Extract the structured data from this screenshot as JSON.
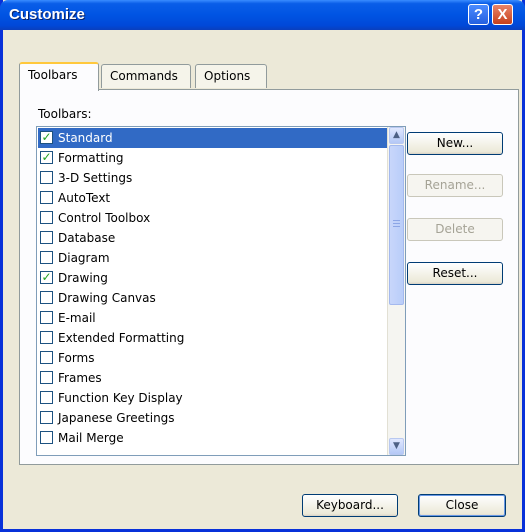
{
  "window": {
    "title": "Customize",
    "help_label": "?",
    "close_label": "X"
  },
  "tabs": [
    {
      "label": "Toolbars",
      "active": true
    },
    {
      "label": "Commands",
      "active": false
    },
    {
      "label": "Options",
      "active": false
    }
  ],
  "toolbars_label": "Toolbars:",
  "toolbars": [
    {
      "name": "Standard",
      "checked": true,
      "selected": true
    },
    {
      "name": "Formatting",
      "checked": true,
      "selected": false
    },
    {
      "name": "3-D Settings",
      "checked": false,
      "selected": false
    },
    {
      "name": "AutoText",
      "checked": false,
      "selected": false
    },
    {
      "name": "Control Toolbox",
      "checked": false,
      "selected": false
    },
    {
      "name": "Database",
      "checked": false,
      "selected": false
    },
    {
      "name": "Diagram",
      "checked": false,
      "selected": false
    },
    {
      "name": "Drawing",
      "checked": true,
      "selected": false
    },
    {
      "name": "Drawing Canvas",
      "checked": false,
      "selected": false
    },
    {
      "name": "E-mail",
      "checked": false,
      "selected": false
    },
    {
      "name": "Extended Formatting",
      "checked": false,
      "selected": false
    },
    {
      "name": "Forms",
      "checked": false,
      "selected": false
    },
    {
      "name": "Frames",
      "checked": false,
      "selected": false
    },
    {
      "name": "Function Key Display",
      "checked": false,
      "selected": false
    },
    {
      "name": "Japanese Greetings",
      "checked": false,
      "selected": false
    },
    {
      "name": "Mail Merge",
      "checked": false,
      "selected": false
    }
  ],
  "side_buttons": {
    "new": "New...",
    "rename": "Rename...",
    "delete": "Delete",
    "reset": "Reset..."
  },
  "bottom_buttons": {
    "keyboard": "Keyboard...",
    "close": "Close"
  },
  "colors": {
    "titlebar": "#0054e3",
    "selection": "#316ac5",
    "check": "#21a121"
  }
}
